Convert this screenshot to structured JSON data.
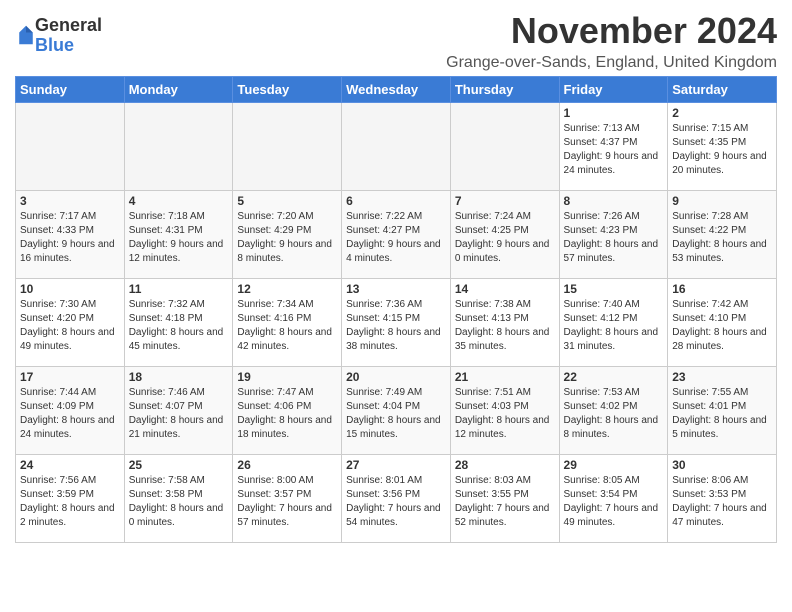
{
  "logo": {
    "general": "General",
    "blue": "Blue"
  },
  "title": "November 2024",
  "location": "Grange-over-Sands, England, United Kingdom",
  "weekdays": [
    "Sunday",
    "Monday",
    "Tuesday",
    "Wednesday",
    "Thursday",
    "Friday",
    "Saturday"
  ],
  "weeks": [
    [
      {
        "day": "",
        "empty": true
      },
      {
        "day": "",
        "empty": true
      },
      {
        "day": "",
        "empty": true
      },
      {
        "day": "",
        "empty": true
      },
      {
        "day": "",
        "empty": true
      },
      {
        "day": "1",
        "sunrise": "Sunrise: 7:13 AM",
        "sunset": "Sunset: 4:37 PM",
        "daylight": "Daylight: 9 hours and 24 minutes."
      },
      {
        "day": "2",
        "sunrise": "Sunrise: 7:15 AM",
        "sunset": "Sunset: 4:35 PM",
        "daylight": "Daylight: 9 hours and 20 minutes."
      }
    ],
    [
      {
        "day": "3",
        "sunrise": "Sunrise: 7:17 AM",
        "sunset": "Sunset: 4:33 PM",
        "daylight": "Daylight: 9 hours and 16 minutes."
      },
      {
        "day": "4",
        "sunrise": "Sunrise: 7:18 AM",
        "sunset": "Sunset: 4:31 PM",
        "daylight": "Daylight: 9 hours and 12 minutes."
      },
      {
        "day": "5",
        "sunrise": "Sunrise: 7:20 AM",
        "sunset": "Sunset: 4:29 PM",
        "daylight": "Daylight: 9 hours and 8 minutes."
      },
      {
        "day": "6",
        "sunrise": "Sunrise: 7:22 AM",
        "sunset": "Sunset: 4:27 PM",
        "daylight": "Daylight: 9 hours and 4 minutes."
      },
      {
        "day": "7",
        "sunrise": "Sunrise: 7:24 AM",
        "sunset": "Sunset: 4:25 PM",
        "daylight": "Daylight: 9 hours and 0 minutes."
      },
      {
        "day": "8",
        "sunrise": "Sunrise: 7:26 AM",
        "sunset": "Sunset: 4:23 PM",
        "daylight": "Daylight: 8 hours and 57 minutes."
      },
      {
        "day": "9",
        "sunrise": "Sunrise: 7:28 AM",
        "sunset": "Sunset: 4:22 PM",
        "daylight": "Daylight: 8 hours and 53 minutes."
      }
    ],
    [
      {
        "day": "10",
        "sunrise": "Sunrise: 7:30 AM",
        "sunset": "Sunset: 4:20 PM",
        "daylight": "Daylight: 8 hours and 49 minutes."
      },
      {
        "day": "11",
        "sunrise": "Sunrise: 7:32 AM",
        "sunset": "Sunset: 4:18 PM",
        "daylight": "Daylight: 8 hours and 45 minutes."
      },
      {
        "day": "12",
        "sunrise": "Sunrise: 7:34 AM",
        "sunset": "Sunset: 4:16 PM",
        "daylight": "Daylight: 8 hours and 42 minutes."
      },
      {
        "day": "13",
        "sunrise": "Sunrise: 7:36 AM",
        "sunset": "Sunset: 4:15 PM",
        "daylight": "Daylight: 8 hours and 38 minutes."
      },
      {
        "day": "14",
        "sunrise": "Sunrise: 7:38 AM",
        "sunset": "Sunset: 4:13 PM",
        "daylight": "Daylight: 8 hours and 35 minutes."
      },
      {
        "day": "15",
        "sunrise": "Sunrise: 7:40 AM",
        "sunset": "Sunset: 4:12 PM",
        "daylight": "Daylight: 8 hours and 31 minutes."
      },
      {
        "day": "16",
        "sunrise": "Sunrise: 7:42 AM",
        "sunset": "Sunset: 4:10 PM",
        "daylight": "Daylight: 8 hours and 28 minutes."
      }
    ],
    [
      {
        "day": "17",
        "sunrise": "Sunrise: 7:44 AM",
        "sunset": "Sunset: 4:09 PM",
        "daylight": "Daylight: 8 hours and 24 minutes."
      },
      {
        "day": "18",
        "sunrise": "Sunrise: 7:46 AM",
        "sunset": "Sunset: 4:07 PM",
        "daylight": "Daylight: 8 hours and 21 minutes."
      },
      {
        "day": "19",
        "sunrise": "Sunrise: 7:47 AM",
        "sunset": "Sunset: 4:06 PM",
        "daylight": "Daylight: 8 hours and 18 minutes."
      },
      {
        "day": "20",
        "sunrise": "Sunrise: 7:49 AM",
        "sunset": "Sunset: 4:04 PM",
        "daylight": "Daylight: 8 hours and 15 minutes."
      },
      {
        "day": "21",
        "sunrise": "Sunrise: 7:51 AM",
        "sunset": "Sunset: 4:03 PM",
        "daylight": "Daylight: 8 hours and 12 minutes."
      },
      {
        "day": "22",
        "sunrise": "Sunrise: 7:53 AM",
        "sunset": "Sunset: 4:02 PM",
        "daylight": "Daylight: 8 hours and 8 minutes."
      },
      {
        "day": "23",
        "sunrise": "Sunrise: 7:55 AM",
        "sunset": "Sunset: 4:01 PM",
        "daylight": "Daylight: 8 hours and 5 minutes."
      }
    ],
    [
      {
        "day": "24",
        "sunrise": "Sunrise: 7:56 AM",
        "sunset": "Sunset: 3:59 PM",
        "daylight": "Daylight: 8 hours and 2 minutes."
      },
      {
        "day": "25",
        "sunrise": "Sunrise: 7:58 AM",
        "sunset": "Sunset: 3:58 PM",
        "daylight": "Daylight: 8 hours and 0 minutes."
      },
      {
        "day": "26",
        "sunrise": "Sunrise: 8:00 AM",
        "sunset": "Sunset: 3:57 PM",
        "daylight": "Daylight: 7 hours and 57 minutes."
      },
      {
        "day": "27",
        "sunrise": "Sunrise: 8:01 AM",
        "sunset": "Sunset: 3:56 PM",
        "daylight": "Daylight: 7 hours and 54 minutes."
      },
      {
        "day": "28",
        "sunrise": "Sunrise: 8:03 AM",
        "sunset": "Sunset: 3:55 PM",
        "daylight": "Daylight: 7 hours and 52 minutes."
      },
      {
        "day": "29",
        "sunrise": "Sunrise: 8:05 AM",
        "sunset": "Sunset: 3:54 PM",
        "daylight": "Daylight: 7 hours and 49 minutes."
      },
      {
        "day": "30",
        "sunrise": "Sunrise: 8:06 AM",
        "sunset": "Sunset: 3:53 PM",
        "daylight": "Daylight: 7 hours and 47 minutes."
      }
    ]
  ]
}
